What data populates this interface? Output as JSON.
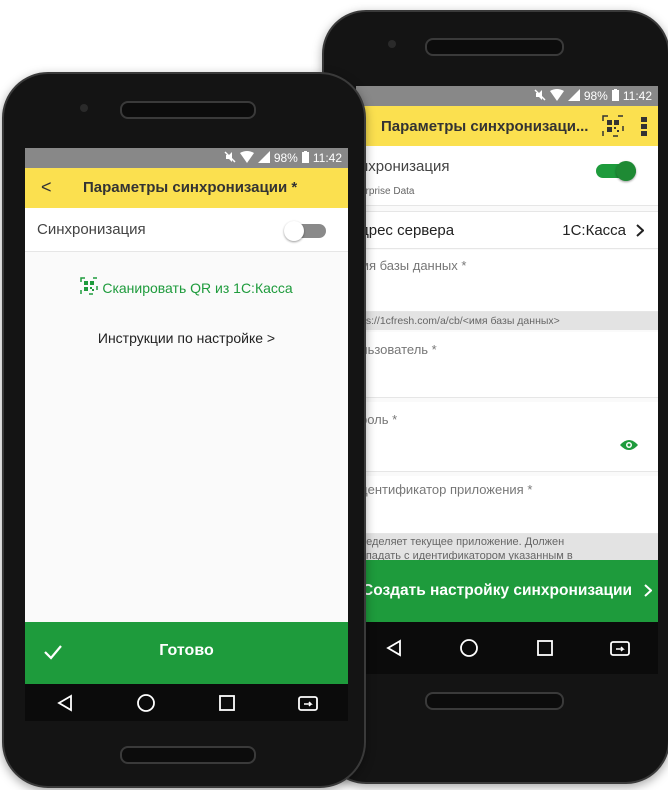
{
  "left_phone": {
    "status": {
      "battery": "98%",
      "time": "11:42"
    },
    "appbar": {
      "back_glyph": "<",
      "title": "Параметры синхронизации *"
    },
    "sync": {
      "label": "Синхронизация",
      "enabled": false
    },
    "scan_link": "Сканировать QR из 1С:Касса",
    "instructions_link": "Инструкции по настройке >",
    "done_button": "Готово"
  },
  "right_phone": {
    "status": {
      "battery": "98%",
      "time": "11:42"
    },
    "appbar": {
      "title": "Параметры синхронизаци..."
    },
    "sync": {
      "label": "нхронизация",
      "sublabel": "erprise Data",
      "enabled": true
    },
    "server": {
      "label": "дрес сервера",
      "value": "1С:Касса"
    },
    "db_name": {
      "label": "мя базы данных *",
      "hint": "ps://1cfresh.com/a/cb/<имя базы данных>"
    },
    "user": {
      "label": "льзователь *"
    },
    "password": {
      "label": "роль *"
    },
    "app_id": {
      "label": "дентификатор приложения *",
      "hint1": "ределяет текущее приложение. Должен",
      "hint2": "впадать с идентификатором указанным в"
    },
    "create_button": "Создать настройку синхронизации"
  },
  "colors": {
    "yellow": "#fbe04f",
    "green": "#1e9b3c",
    "statusbar": "#888888"
  },
  "icons": [
    "mute-icon",
    "wifi-icon",
    "battery-icon",
    "qr-icon",
    "more-vert-icon",
    "eye-icon",
    "check-icon",
    "chevron-right-icon",
    "back-nav-icon",
    "home-nav-icon",
    "recents-nav-icon",
    "rotate-icon"
  ]
}
